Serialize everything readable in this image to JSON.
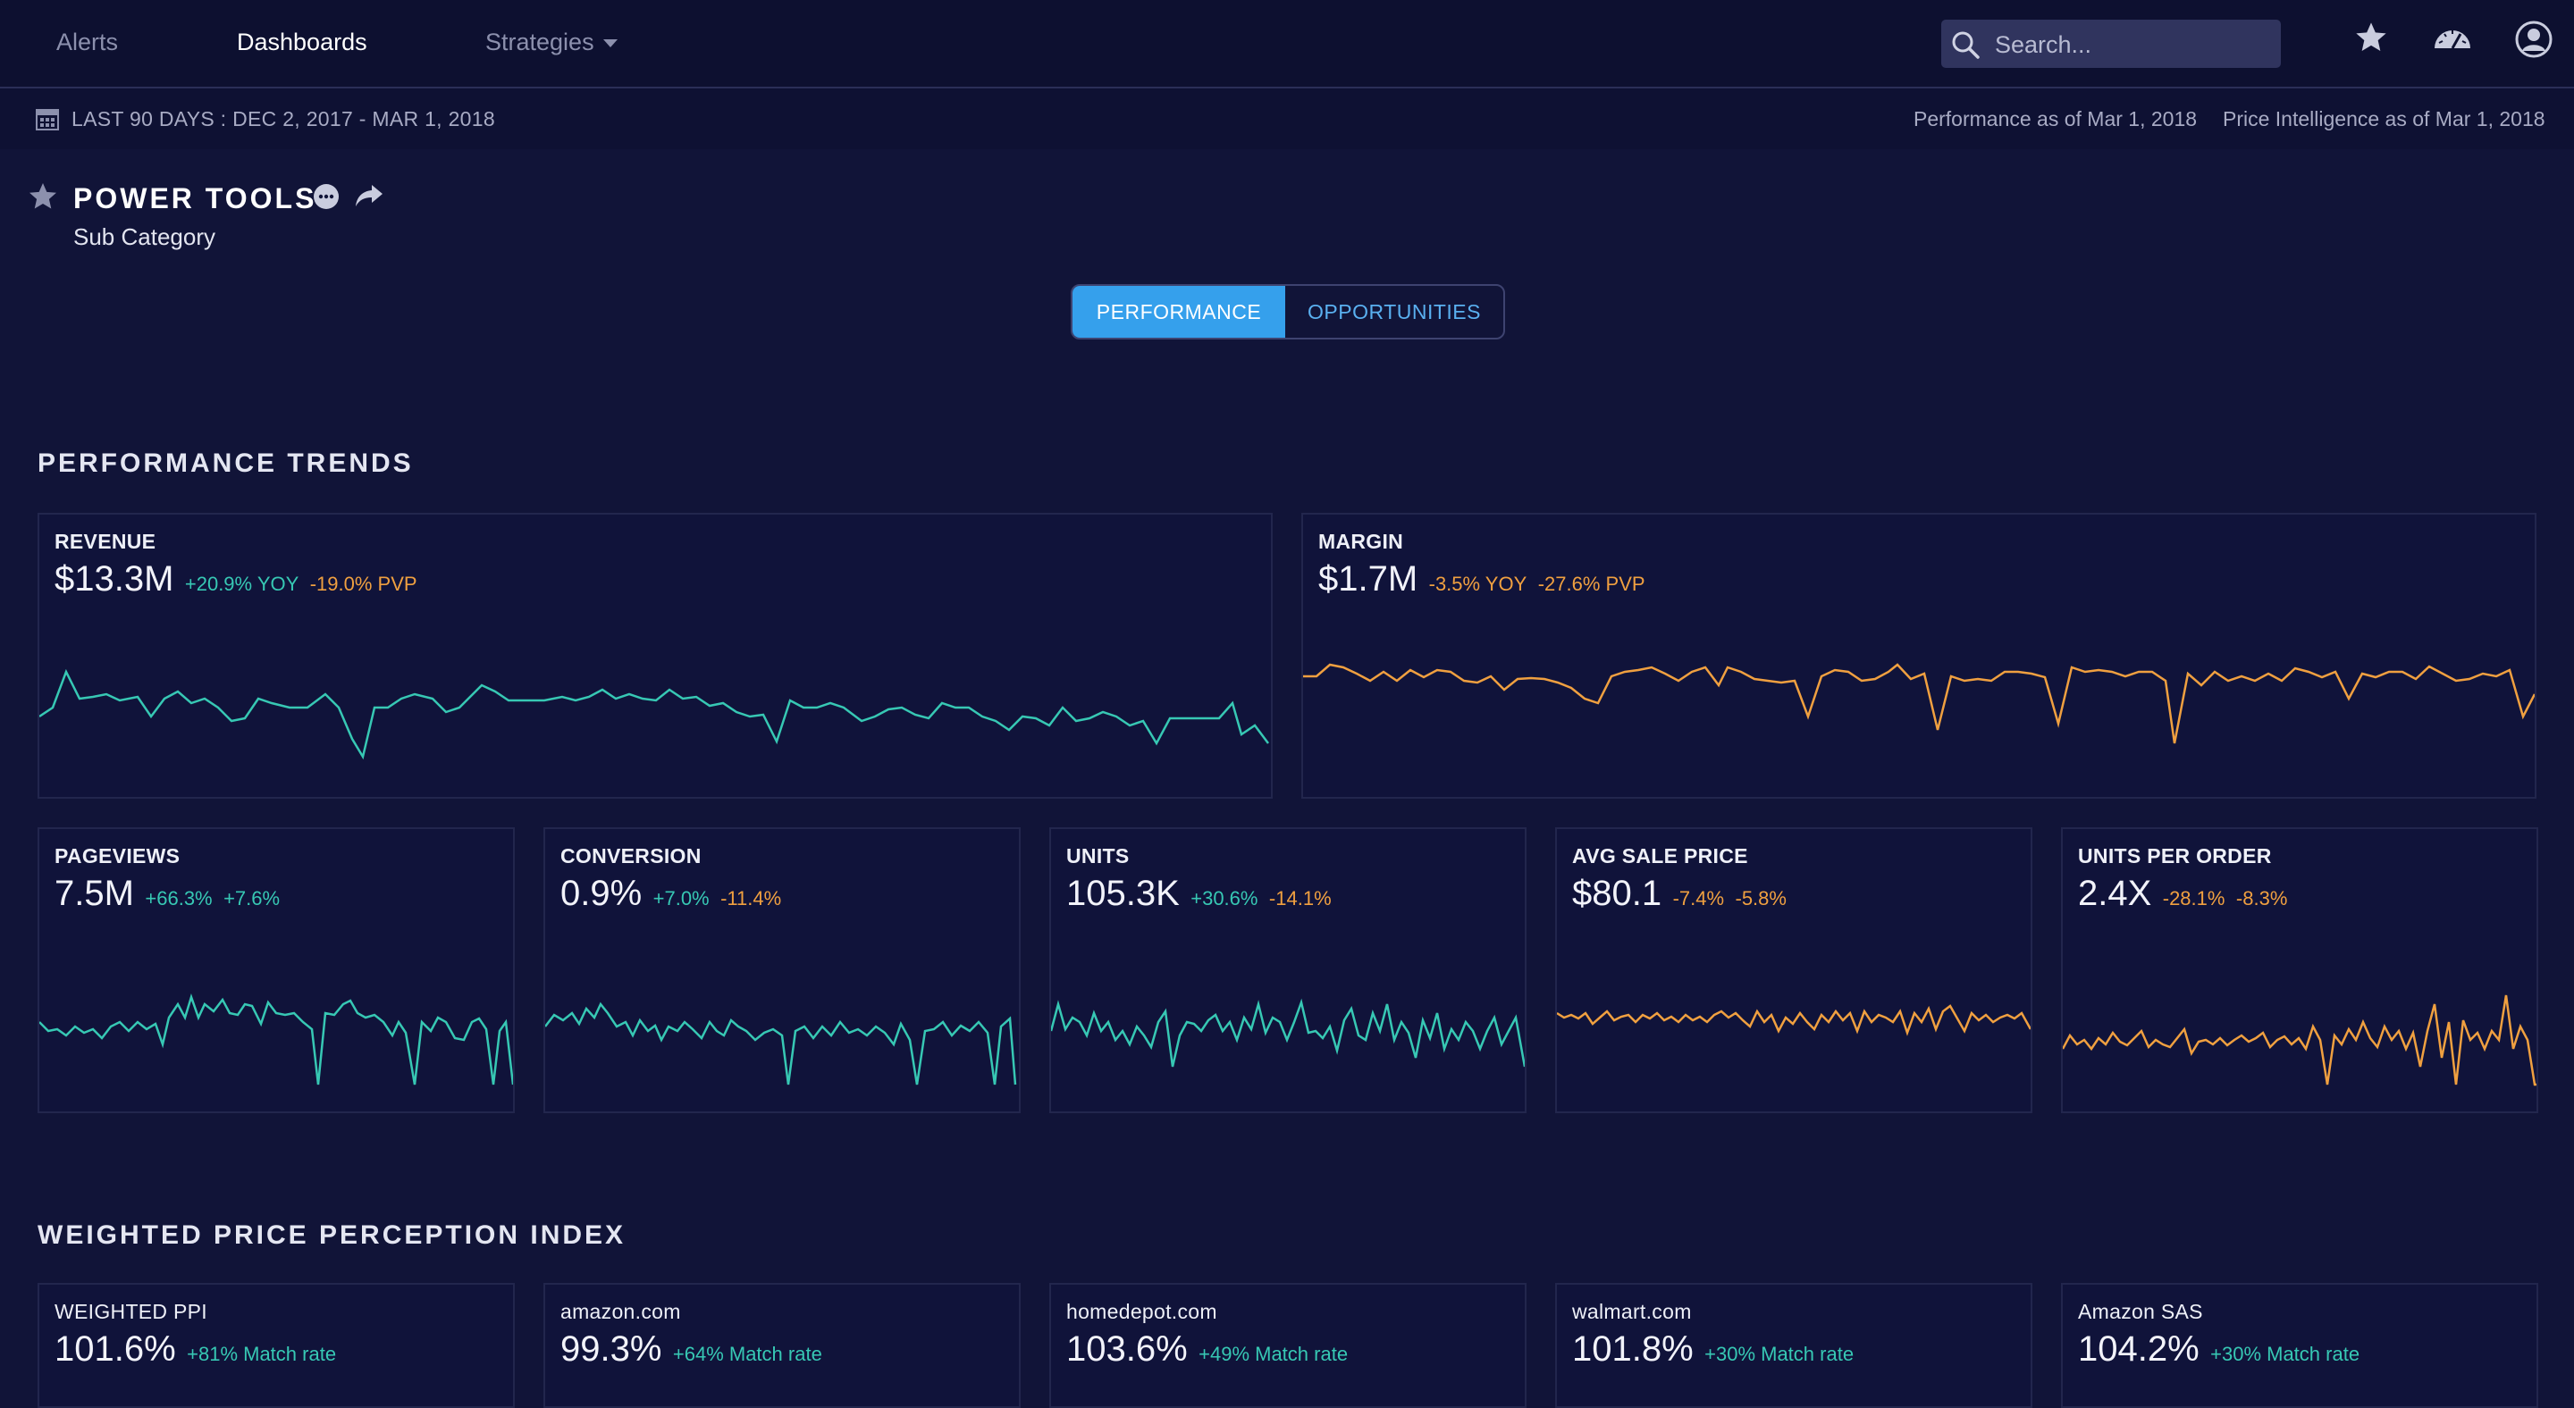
{
  "nav": {
    "items": [
      {
        "label": "Alerts"
      },
      {
        "label": "Dashboards"
      },
      {
        "label": "Strategies"
      }
    ],
    "search_placeholder": "Search..."
  },
  "datebar": {
    "range": "LAST 90 DAYS : DEC 2, 2017 - MAR 1, 2018",
    "performance_asof": "Performance as of Mar 1, 2018",
    "price_asof": "Price Intelligence as of Mar 1, 2018"
  },
  "header": {
    "title": "POWER TOOLS",
    "subtitle": "Sub Category"
  },
  "toggle": {
    "performance": "PERFORMANCE",
    "opportunities": "OPPORTUNITIES"
  },
  "colors": {
    "positive": "#37c8b4",
    "negative": "#f0a040",
    "accent": "#35a0ec",
    "background": "#111438"
  },
  "performance_trends": {
    "title": "PERFORMANCE TRENDS",
    "cards": {
      "revenue": {
        "label": "REVENUE",
        "value": "$13.3M",
        "d1": "+20.9% YOY",
        "d2": "-19.0% PVP"
      },
      "margin": {
        "label": "MARGIN",
        "value": "$1.7M",
        "d1": "-3.5% YOY",
        "d2": "-27.6% PVP"
      },
      "pageviews": {
        "label": "PAGEVIEWS",
        "value": "7.5M",
        "d1": "+66.3%",
        "d2": "+7.6%"
      },
      "conversion": {
        "label": "CONVERSION",
        "value": "0.9%",
        "d1": "+7.0%",
        "d2": "-11.4%"
      },
      "units": {
        "label": "UNITS",
        "value": "105.3K",
        "d1": "+30.6%",
        "d2": "-14.1%"
      },
      "avg_sale_price": {
        "label": "AVG SALE PRICE",
        "value": "$80.1",
        "d1": "-7.4%",
        "d2": "-5.8%"
      },
      "units_per_order": {
        "label": "UNITS PER ORDER",
        "value": "2.4X",
        "d1": "-28.1%",
        "d2": "-8.3%"
      }
    }
  },
  "wppi": {
    "title": "WEIGHTED PRICE PERCEPTION INDEX",
    "cards": [
      {
        "label": "WEIGHTED PPI",
        "value": "101.6%",
        "match": "+81% Match rate"
      },
      {
        "label": "amazon.com",
        "value": "99.3%",
        "match": "+64% Match rate"
      },
      {
        "label": "homedepot.com",
        "value": "103.6%",
        "match": "+49% Match rate"
      },
      {
        "label": "walmart.com",
        "value": "101.8%",
        "match": "+30% Match rate"
      },
      {
        "label": "Amazon SAS",
        "value": "104.2%",
        "match": "+30% Match rate"
      }
    ]
  }
}
